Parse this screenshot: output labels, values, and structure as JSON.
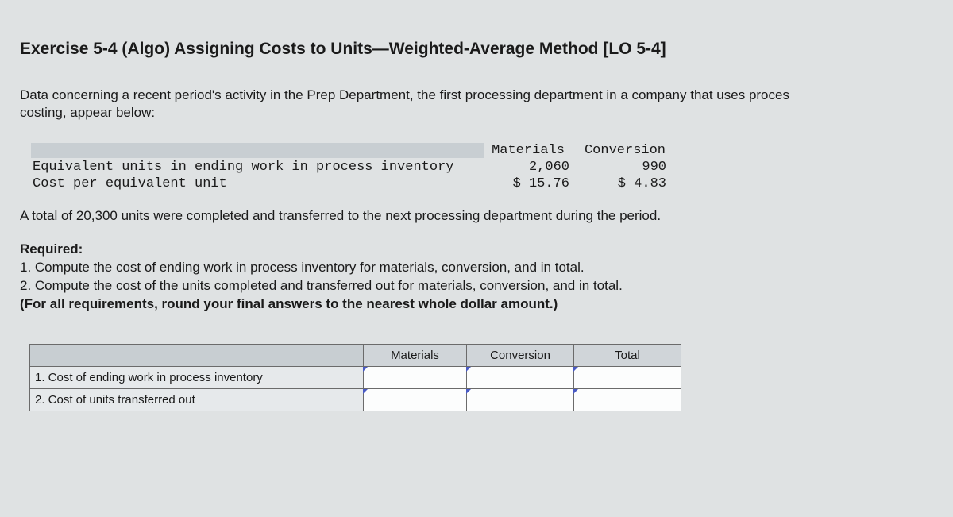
{
  "title": "Exercise 5-4 (Algo) Assigning Costs to Units—Weighted-Average Method [LO 5-4]",
  "intro": "Data concerning a recent period's activity in the Prep Department, the first processing department in a company that uses proces\ncosting, appear below:",
  "data_table": {
    "headers": {
      "materials": "Materials",
      "conversion": "Conversion"
    },
    "rows": [
      {
        "label": "Equivalent units in ending work in process inventory",
        "materials": "2,060",
        "conversion": "990"
      },
      {
        "label": "Cost per equivalent unit",
        "materials": "$ 15.76",
        "conversion": "$ 4.83"
      }
    ]
  },
  "transfer_para": "A total of 20,300 units were completed and transferred to the next processing department during the period.",
  "required": {
    "heading": "Required:",
    "item1": "1. Compute the cost of ending work in process inventory for materials, conversion, and in total.",
    "item2": "2. Compute the cost of the units completed and transferred out for materials, conversion, and in total.",
    "note": "(For all requirements, round your final answers to the nearest whole dollar amount.)"
  },
  "answer_table": {
    "headers": {
      "materials": "Materials",
      "conversion": "Conversion",
      "total": "Total"
    },
    "rows": [
      {
        "label": "1. Cost of ending work in process inventory"
      },
      {
        "label": "2. Cost of units transferred out"
      }
    ]
  }
}
